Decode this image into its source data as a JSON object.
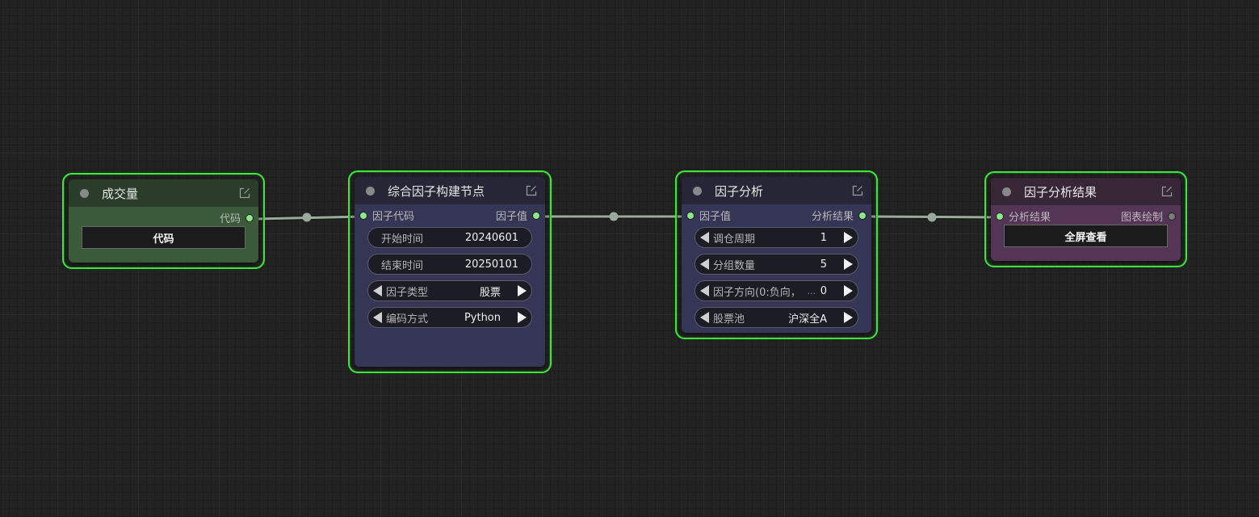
{
  "nodes": {
    "volume": {
      "title": "成交量",
      "output_label": "代码",
      "button_label": "代码",
      "header_color": "#2a3d2a",
      "body_color": "#3a5a3a"
    },
    "builder": {
      "title": "综合因子构建节点",
      "input_label": "因子代码",
      "output_label": "因子值",
      "header_color": "#262636",
      "body_color": "#353555",
      "widgets": [
        {
          "label": "开始时间",
          "value": "20240601"
        },
        {
          "label": "结束时间",
          "value": "20250101"
        },
        {
          "label": "因子类型",
          "value": "股票"
        },
        {
          "label": "编码方式",
          "value": "Python"
        }
      ]
    },
    "analysis": {
      "title": "因子分析",
      "input_label": "因子值",
      "output_label": "分析结果",
      "header_color": "#262636",
      "body_color": "#353555",
      "widgets": [
        {
          "label": "调仓周期",
          "value": "1"
        },
        {
          "label": "分组数量",
          "value": "5"
        },
        {
          "label": "因子方向(0:负向，",
          "ellipsis": "...",
          "value": "0"
        },
        {
          "label": "股票池",
          "value": "沪深全A"
        }
      ]
    },
    "result": {
      "title": "因子分析结果",
      "input_label": "分析结果",
      "output_label": "图表绘制",
      "button_label": "全屏查看",
      "header_color": "#362636",
      "body_color": "#553555"
    }
  },
  "icons": {
    "status_dot": "status-dot-icon",
    "edit": "edit-icon",
    "arrow_left": "arrow-left-icon",
    "arrow_right": "arrow-right-icon"
  },
  "colors": {
    "selection_border": "#3de63d",
    "link": "#9aaa9a",
    "port_connected": "#8de88d",
    "canvas": "#222222"
  }
}
